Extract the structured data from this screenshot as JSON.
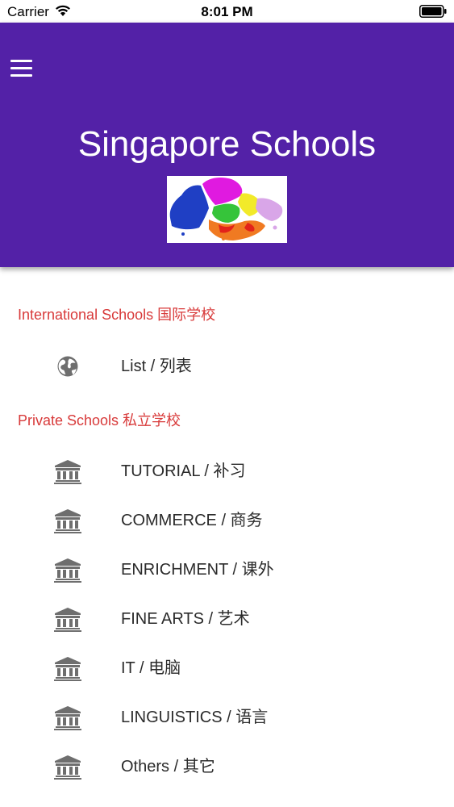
{
  "status_bar": {
    "carrier": "Carrier",
    "time": "8:01 PM",
    "wifi_icon": "wifi-icon",
    "battery_icon": "battery-icon"
  },
  "header": {
    "title": "Singapore Schools",
    "menu_icon": "hamburger-menu-icon",
    "background_color": "#5321a7"
  },
  "sections": [
    {
      "title": "International Schools 国际学校",
      "items": [
        {
          "label": "List / 列表",
          "icon": "globe-icon"
        }
      ]
    },
    {
      "title": "Private Schools 私立学校",
      "items": [
        {
          "label": "TUTORIAL / 补习",
          "icon": "institution-icon"
        },
        {
          "label": "COMMERCE / 商务",
          "icon": "institution-icon"
        },
        {
          "label": "ENRICHMENT / 课外",
          "icon": "institution-icon"
        },
        {
          "label": "FINE ARTS / 艺术",
          "icon": "institution-icon"
        },
        {
          "label": "IT / 电脑",
          "icon": "institution-icon"
        },
        {
          "label": "LINGUISTICS / 语言",
          "icon": "institution-icon"
        },
        {
          "label": "Others / 其它",
          "icon": "institution-icon"
        }
      ]
    }
  ],
  "colors": {
    "section_header": "#d83a3a",
    "icon": "#6e6e6e"
  }
}
